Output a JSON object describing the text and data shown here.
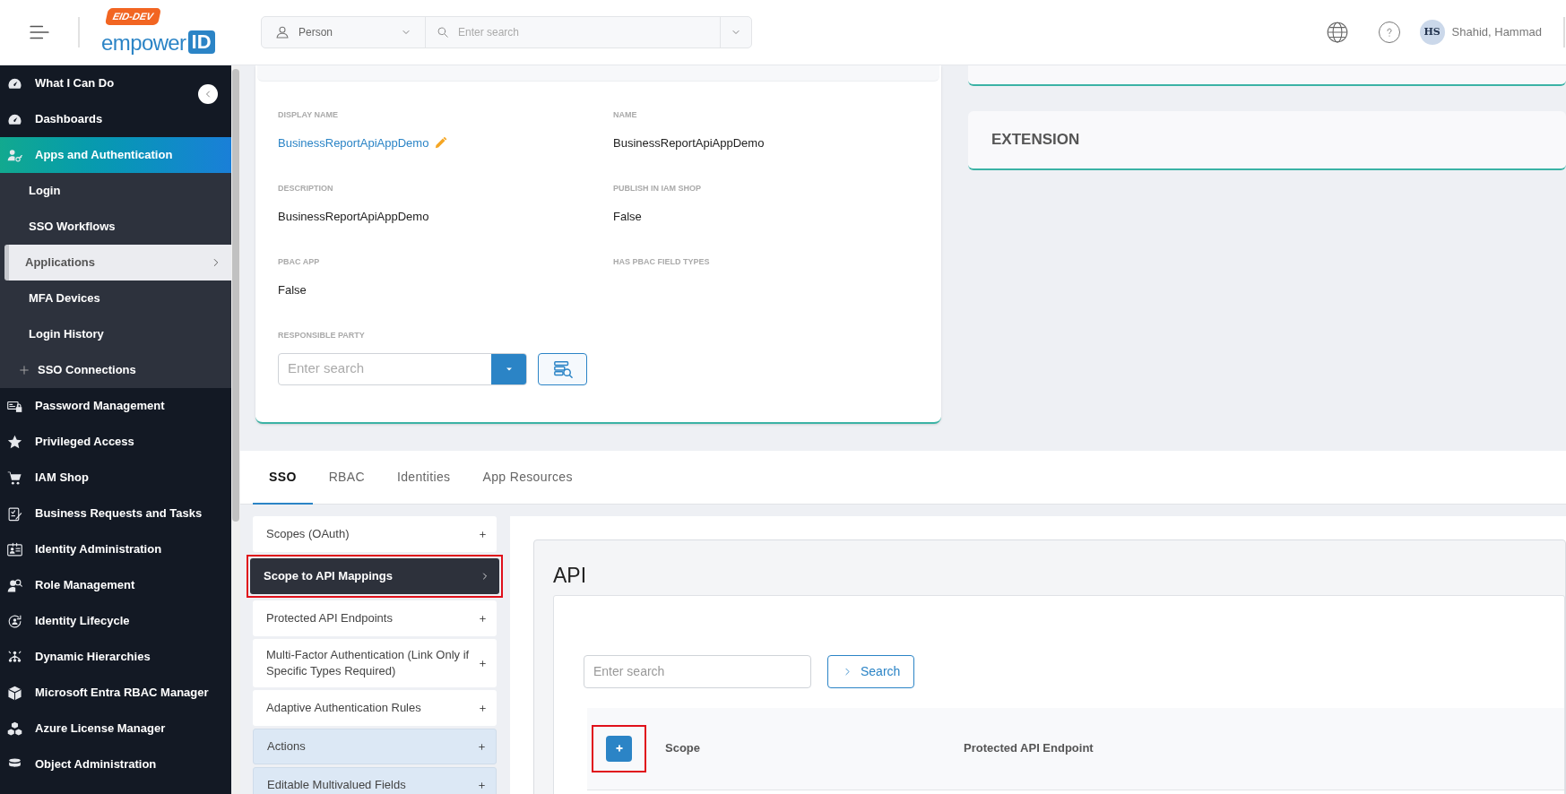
{
  "header": {
    "env_badge": "EID-DEV",
    "logo_text": "empower",
    "logo_mark": "ID",
    "search": {
      "type": "Person",
      "placeholder": "Enter search"
    },
    "user": {
      "initials": "HS",
      "name": "Shahid, Hammad"
    }
  },
  "sidebar": {
    "items": [
      {
        "label": "What I Can Do",
        "selected": false
      },
      {
        "label": "Dashboards",
        "selected": false
      },
      {
        "label": "Apps and Authentication",
        "selected": true,
        "expanded": true,
        "children": [
          {
            "label": "Login",
            "selected": false,
            "expandable": false
          },
          {
            "label": "SSO Workflows",
            "selected": false,
            "expandable": false
          },
          {
            "label": "Applications",
            "selected": true,
            "expandable": false
          },
          {
            "label": "MFA Devices",
            "selected": false,
            "expandable": false
          },
          {
            "label": "Login History",
            "selected": false,
            "expandable": false
          },
          {
            "label": "SSO Connections",
            "selected": false,
            "expandable": true
          }
        ]
      },
      {
        "label": "Password Management",
        "selected": false
      },
      {
        "label": "Privileged Access",
        "selected": false
      },
      {
        "label": "IAM Shop",
        "selected": false
      },
      {
        "label": "Business Requests and Tasks",
        "selected": false
      },
      {
        "label": "Identity Administration",
        "selected": false
      },
      {
        "label": "Role Management",
        "selected": false
      },
      {
        "label": "Identity Lifecycle",
        "selected": false
      },
      {
        "label": "Dynamic Hierarchies",
        "selected": false
      },
      {
        "label": "Microsoft Entra RBAC Manager",
        "selected": false
      },
      {
        "label": "Azure License Manager",
        "selected": false
      },
      {
        "label": "Object Administration",
        "selected": false
      }
    ]
  },
  "detail": {
    "fields": [
      {
        "label": "DISPLAY NAME",
        "value": "BusinessReportApiAppDemo",
        "kind": "link"
      },
      {
        "label": "NAME",
        "value": "BusinessReportApiAppDemo",
        "kind": "text"
      },
      {
        "label": "DESCRIPTION",
        "value": "BusinessReportApiAppDemo",
        "kind": "text"
      },
      {
        "label": "PUBLISH IN IAM SHOP",
        "value": "False",
        "kind": "text"
      },
      {
        "label": "PBAC APP",
        "value": "False",
        "kind": "text"
      },
      {
        "label": "HAS PBAC FIELD TYPES"
      }
    ],
    "responsible_party": {
      "label": "RESPONSIBLE PARTY",
      "placeholder": "Enter search"
    }
  },
  "extension": {
    "title": "EXTENSION"
  },
  "tabs": [
    {
      "label": "SSO",
      "selected": true
    },
    {
      "label": "RBAC",
      "selected": false
    },
    {
      "label": "Identities",
      "selected": false
    },
    {
      "label": "App Resources",
      "selected": false
    }
  ],
  "sections": [
    {
      "label": "Scopes (OAuth)",
      "selected": false,
      "tinted": false,
      "annotated": false
    },
    {
      "label": "Scope to API Mappings",
      "selected": true,
      "tinted": false,
      "annotated": true
    },
    {
      "label": "Protected API Endpoints",
      "selected": false,
      "tinted": false,
      "annotated": false
    },
    {
      "label": "Multi-Factor Authentication (Link Only if Specific Types Required)",
      "selected": false,
      "tinted": false,
      "annotated": false
    },
    {
      "label": "Adaptive Authentication Rules",
      "selected": false,
      "tinted": false,
      "annotated": false
    },
    {
      "label": "Actions",
      "selected": false,
      "tinted": true,
      "annotated": false
    },
    {
      "label": "Editable Multivalued Fields",
      "selected": false,
      "tinted": true,
      "annotated": false
    }
  ],
  "api": {
    "title": "API",
    "search": {
      "placeholder": "Enter search"
    },
    "search_button": "Search",
    "add_annotated": true,
    "columns": [
      "Scope",
      "Protected API Endpoint"
    ]
  }
}
